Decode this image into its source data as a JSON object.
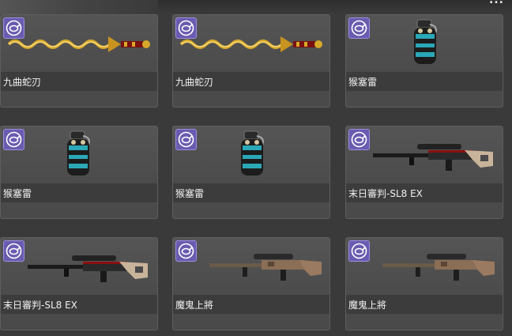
{
  "header": {
    "count_text": "..."
  },
  "items": [
    {
      "name": "九曲蛇刃",
      "kind": "sword"
    },
    {
      "name": "九曲蛇刃",
      "kind": "sword"
    },
    {
      "name": "猴塞雷",
      "kind": "grenade"
    },
    {
      "name": "猴塞雷",
      "kind": "grenade"
    },
    {
      "name": "猴塞雷",
      "kind": "grenade"
    },
    {
      "name": "末日審判-SL8 EX",
      "kind": "rifle-black"
    },
    {
      "name": "末日審判-SL8 EX",
      "kind": "rifle-black"
    },
    {
      "name": "魔鬼上將",
      "kind": "rifle-camo"
    },
    {
      "name": "魔鬼上將",
      "kind": "rifle-camo"
    }
  ],
  "colors": {
    "badge": "#6a5bb0",
    "card": "#4a4a4a",
    "gold": "#d8a82a"
  }
}
